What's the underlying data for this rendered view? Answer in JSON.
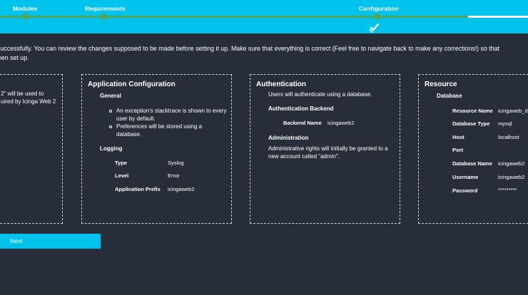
{
  "wizard": {
    "steps": [
      {
        "label": "Modules"
      },
      {
        "label": "Requirements"
      },
      {
        "label": "Configuration"
      }
    ]
  },
  "colors": {
    "accent": "#00c3ed",
    "background": "#282e39",
    "progress": "#4fa65c"
  },
  "intro": {
    "line1": "successfully. You can review the changes supposed to be made before setting it up. Make sure that everything is correct (Feel free to navigate back to make any corrections!) so that",
    "line2": "een set up."
  },
  "left_card": {
    "line1": "2\" will be used to",
    "line2": "uired by Icinga Web 2"
  },
  "app_config": {
    "title": "Application Configuration",
    "general_heading": "General",
    "bullets": [
      "An exception's stacktrace is shown to every user by default.",
      "Preferences will be stored using a database."
    ],
    "logging_heading": "Logging",
    "rows": [
      {
        "label": "Type",
        "value": "Syslog"
      },
      {
        "label": "Level",
        "value": "Error"
      },
      {
        "label": "Application Prefix",
        "value": "icingaweb2"
      }
    ]
  },
  "authentication": {
    "title": "Authentication",
    "intro": "Users will authenticate using a database.",
    "backend_heading": "Authentication Backend",
    "backend_label": "Backend Name",
    "backend_value": "icingaweb2",
    "admin_heading": "Administration",
    "admin_text": "Administrative rights will initially be granted to a new account called \"admin\"."
  },
  "resource": {
    "title": "Resource",
    "db_heading": "Database",
    "rows": [
      {
        "label": "Resource Name",
        "value": "icingaweb_db"
      },
      {
        "label": "Database Type",
        "value": "mysql"
      },
      {
        "label": "Host",
        "value": "localhost"
      },
      {
        "label": "Port",
        "value": ""
      },
      {
        "label": "Database Name",
        "value": "icingaweb2"
      },
      {
        "label": "Username",
        "value": "icingaweb2"
      },
      {
        "label": "Password",
        "value": "*********"
      }
    ]
  },
  "buttons": {
    "next_label": "Next"
  },
  "icons": {
    "current_step": "check-arrow-icon"
  }
}
